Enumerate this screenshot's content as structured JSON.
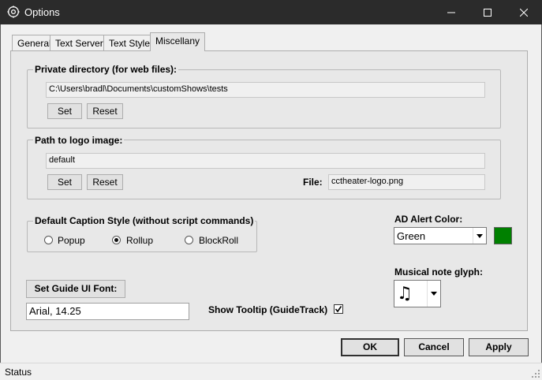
{
  "window": {
    "title": "Options",
    "controls": [
      "minimize-icon",
      "maximize-icon",
      "close-icon"
    ]
  },
  "tabs": [
    {
      "label": "General"
    },
    {
      "label": "Text Server"
    },
    {
      "label": "Text Style"
    },
    {
      "label": "Miscellany",
      "active": true
    }
  ],
  "private_dir": {
    "group_label": "Private directory (for web files):",
    "path": "C:\\Users\\bradl\\Documents\\customShows\\tests",
    "set_label": "Set",
    "reset_label": "Reset"
  },
  "logo": {
    "group_label": "Path to logo image:",
    "path": "default",
    "set_label": "Set",
    "reset_label": "Reset",
    "file_label": "File:",
    "file_value": "cctheater-logo.png"
  },
  "caption_style": {
    "group_label": "Default Caption Style (without script commands)",
    "options": [
      {
        "label": "Popup",
        "selected": false
      },
      {
        "label": "Rollup",
        "selected": true
      },
      {
        "label": "BlockRoll",
        "selected": false
      }
    ]
  },
  "ad_alert": {
    "label": "AD Alert Color:",
    "value": "Green",
    "swatch_color": "#008000"
  },
  "musical_note": {
    "label": "Musical note glyph:",
    "value": "♫"
  },
  "guide_font": {
    "button_label": "Set Guide UI Font:",
    "value": "Arial, 14.25"
  },
  "tooltip": {
    "label": "Show Tooltip (GuideTrack)",
    "checked": true
  },
  "footer": {
    "ok_label": "OK",
    "cancel_label": "Cancel",
    "apply_label": "Apply"
  },
  "status": {
    "text": "Status"
  }
}
